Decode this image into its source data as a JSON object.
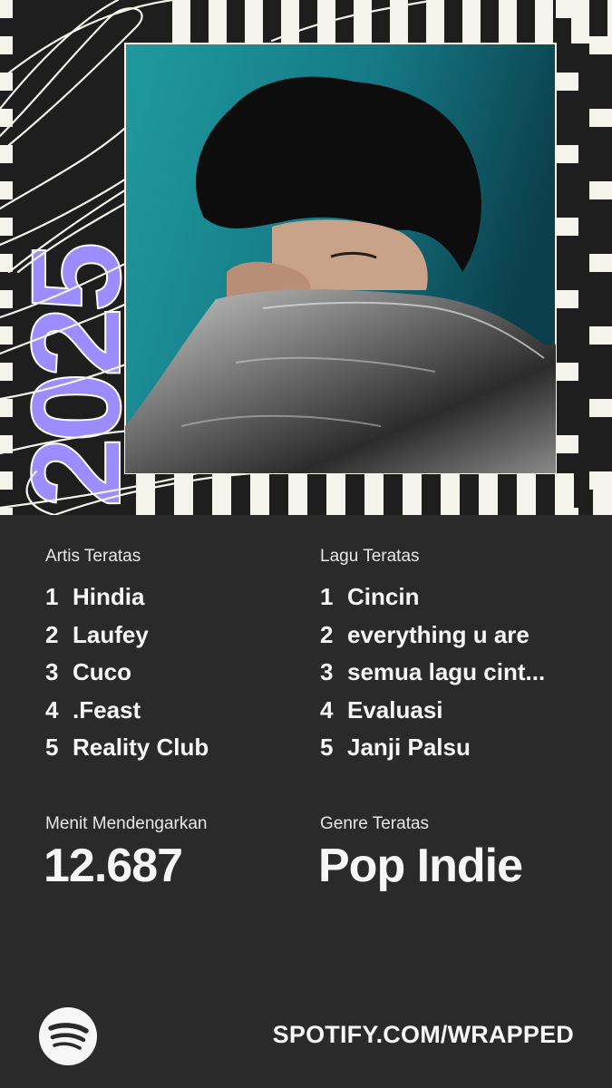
{
  "hero": {
    "year_text": "2025",
    "colors": {
      "accent": "#9b8cff",
      "background": "#1e1e1e",
      "stripe": "#f4f3ec"
    }
  },
  "stats": {
    "top_artists": {
      "label": "Artis Teratas",
      "items": [
        {
          "rank": "1",
          "name": "Hindia"
        },
        {
          "rank": "2",
          "name": "Laufey"
        },
        {
          "rank": "3",
          "name": "Cuco"
        },
        {
          "rank": "4",
          "name": ".Feast"
        },
        {
          "rank": "5",
          "name": "Reality Club"
        }
      ]
    },
    "top_songs": {
      "label": "Lagu Teratas",
      "items": [
        {
          "rank": "1",
          "name": "Cincin"
        },
        {
          "rank": "2",
          "name": "everything u are"
        },
        {
          "rank": "3",
          "name": "semua lagu cint..."
        },
        {
          "rank": "4",
          "name": "Evaluasi"
        },
        {
          "rank": "5",
          "name": "Janji Palsu"
        }
      ]
    },
    "minutes": {
      "label": "Menit Mendengarkan",
      "value": "12.687"
    },
    "genre": {
      "label": "Genre Teratas",
      "value": "Pop Indie"
    }
  },
  "footer": {
    "logo_icon": "spotify-logo-icon",
    "url": "SPOTIFY.COM/WRAPPED"
  },
  "colors": {
    "page_background": "#2a2a2a",
    "text": "#f6f6f6"
  }
}
